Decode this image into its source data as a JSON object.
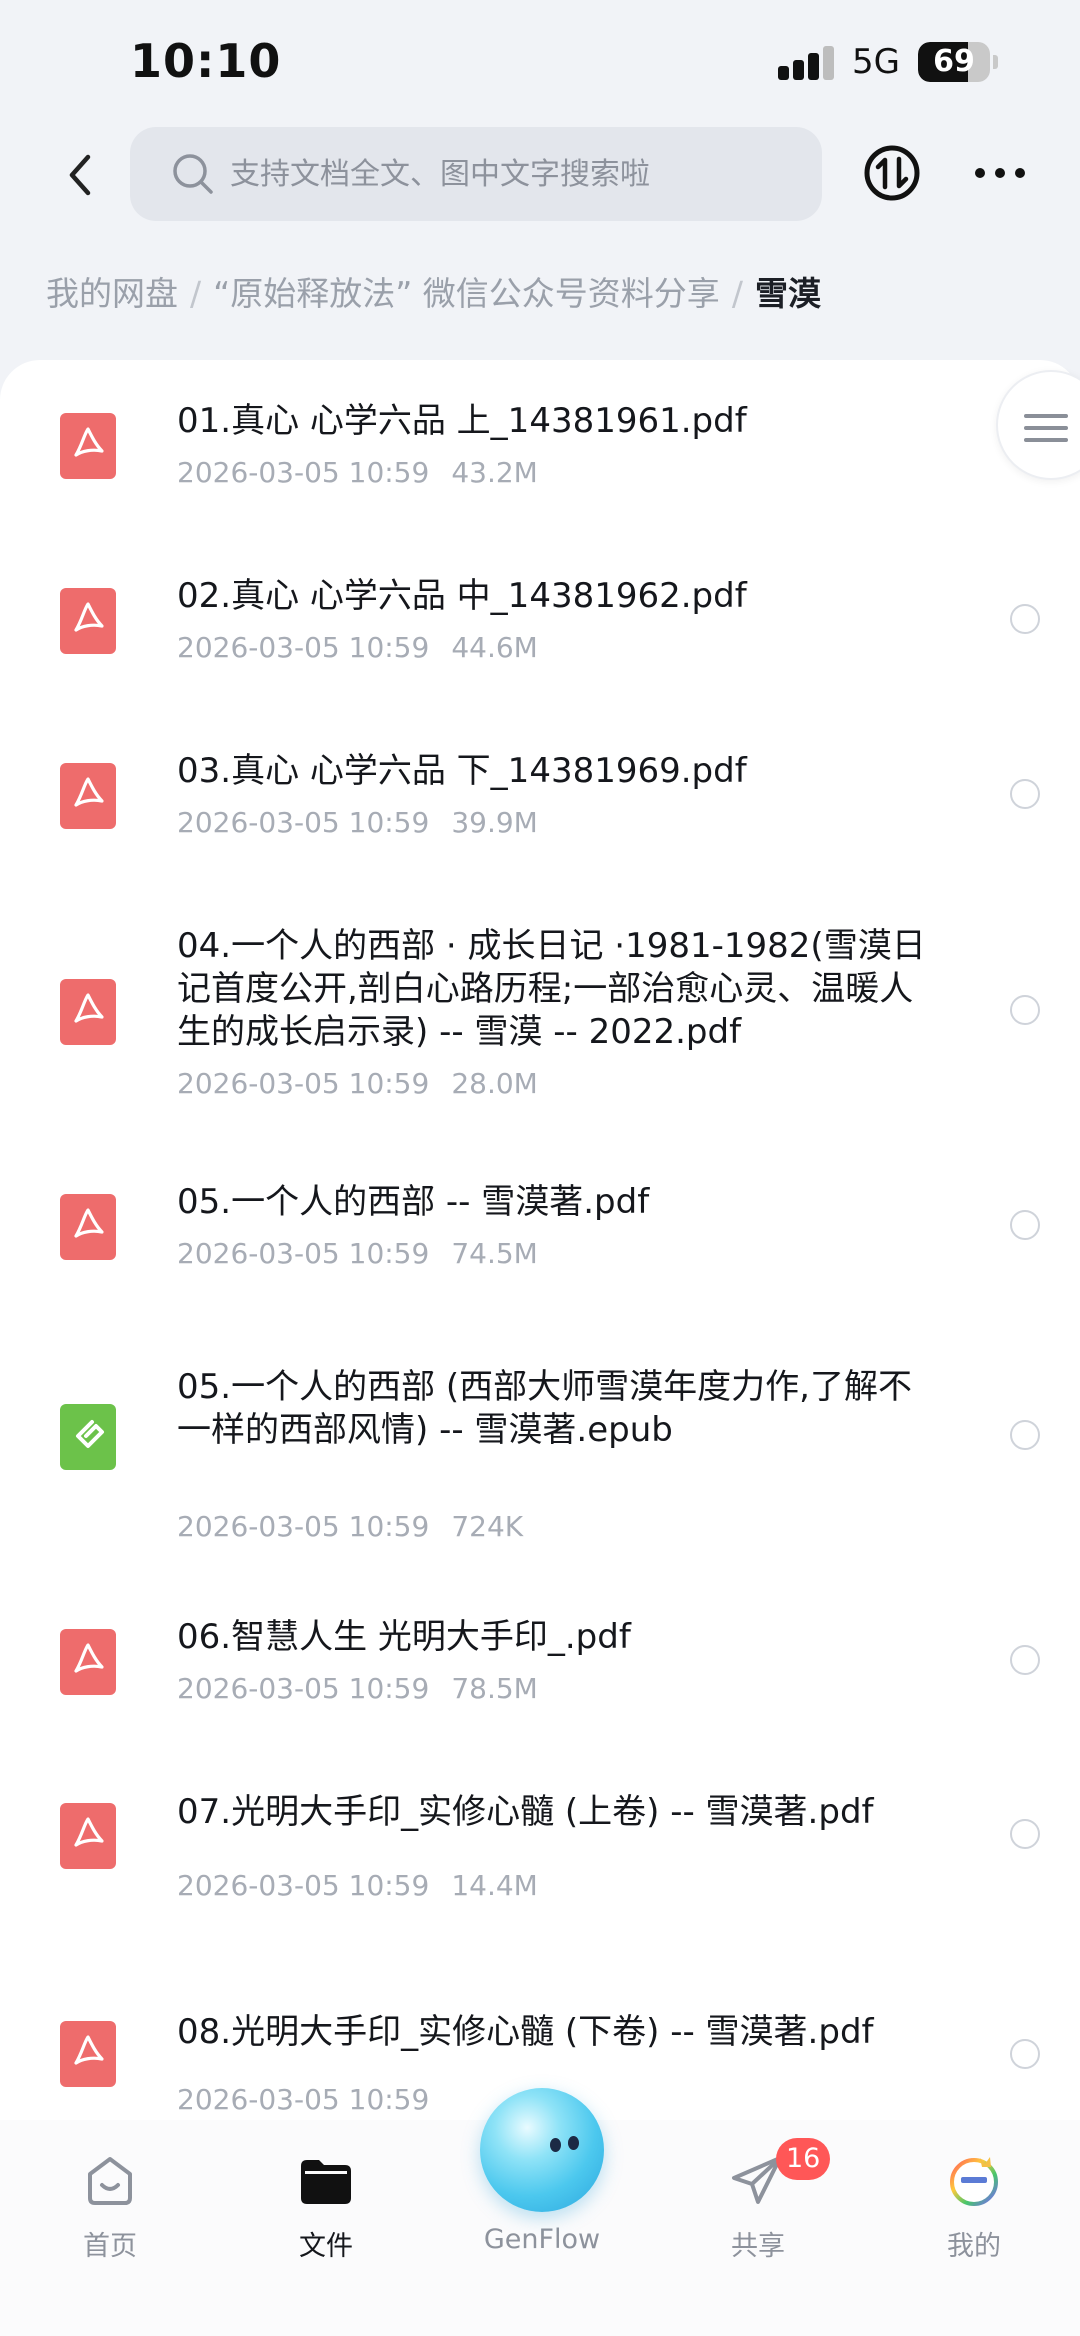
{
  "status_bar": {
    "time": "10:10",
    "network": "5G",
    "battery": "69",
    "battery_level": 0.69
  },
  "header": {
    "search_placeholder": "支持文档全文、图中文字搜索啦"
  },
  "breadcrumb": {
    "items": [
      "我的网盘",
      "“原始释放法” 微信公众号资料分享"
    ],
    "current": "雪漠"
  },
  "files": [
    {
      "name": "01.真心  心学六品  上_14381961.pdf",
      "date": "2026-03-05 10:59",
      "size": "43.2M",
      "type": "pdf"
    },
    {
      "name": "02.真心  心学六品  中_14381962.pdf",
      "date": "2026-03-05 10:59",
      "size": "44.6M",
      "type": "pdf"
    },
    {
      "name": "03.真心  心学六品  下_14381969.pdf",
      "date": "2026-03-05 10:59",
      "size": "39.9M",
      "type": "pdf"
    },
    {
      "name": "04.一个人的西部 · 成长日记 ·1981-1982(雪漠日记首度公开,剖白心路历程;一部治愈心灵、温暖人生的成长启示录) -- 雪漠 -- 2022.pdf",
      "date": "2026-03-05 10:59",
      "size": "28.0M",
      "type": "pdf"
    },
    {
      "name": "05.一个人的西部 -- 雪漠著.pdf",
      "date": "2026-03-05 10:59",
      "size": "74.5M",
      "type": "pdf"
    },
    {
      "name": "05.一个人的西部 (西部大师雪漠年度力作,了解不一样的西部风情) -- 雪漠著.epub",
      "date": "2026-03-05 10:59",
      "size": "724K",
      "type": "epub"
    },
    {
      "name": "06.智慧人生  光明大手印_.pdf",
      "date": "2026-03-05 10:59",
      "size": "78.5M",
      "type": "pdf"
    },
    {
      "name": "07.光明大手印_实修心髓 (上卷) -- 雪漠著.pdf",
      "date": "2026-03-05 10:59",
      "size": "14.4M",
      "type": "pdf"
    },
    {
      "name": "08.光明大手印_实修心髓 (下卷) -- 雪漠著.pdf",
      "date": "2026-03-05 10:59",
      "size": "",
      "type": "pdf"
    }
  ],
  "tabbar": {
    "home": "首页",
    "files": "文件",
    "genflow": "GenFlow",
    "share": "共享",
    "share_badge": "16",
    "mine": "我的"
  },
  "colors": {
    "pdf_icon": "#ee6c6c",
    "epub_icon": "#6cc24a",
    "badge": "#ff5757"
  }
}
